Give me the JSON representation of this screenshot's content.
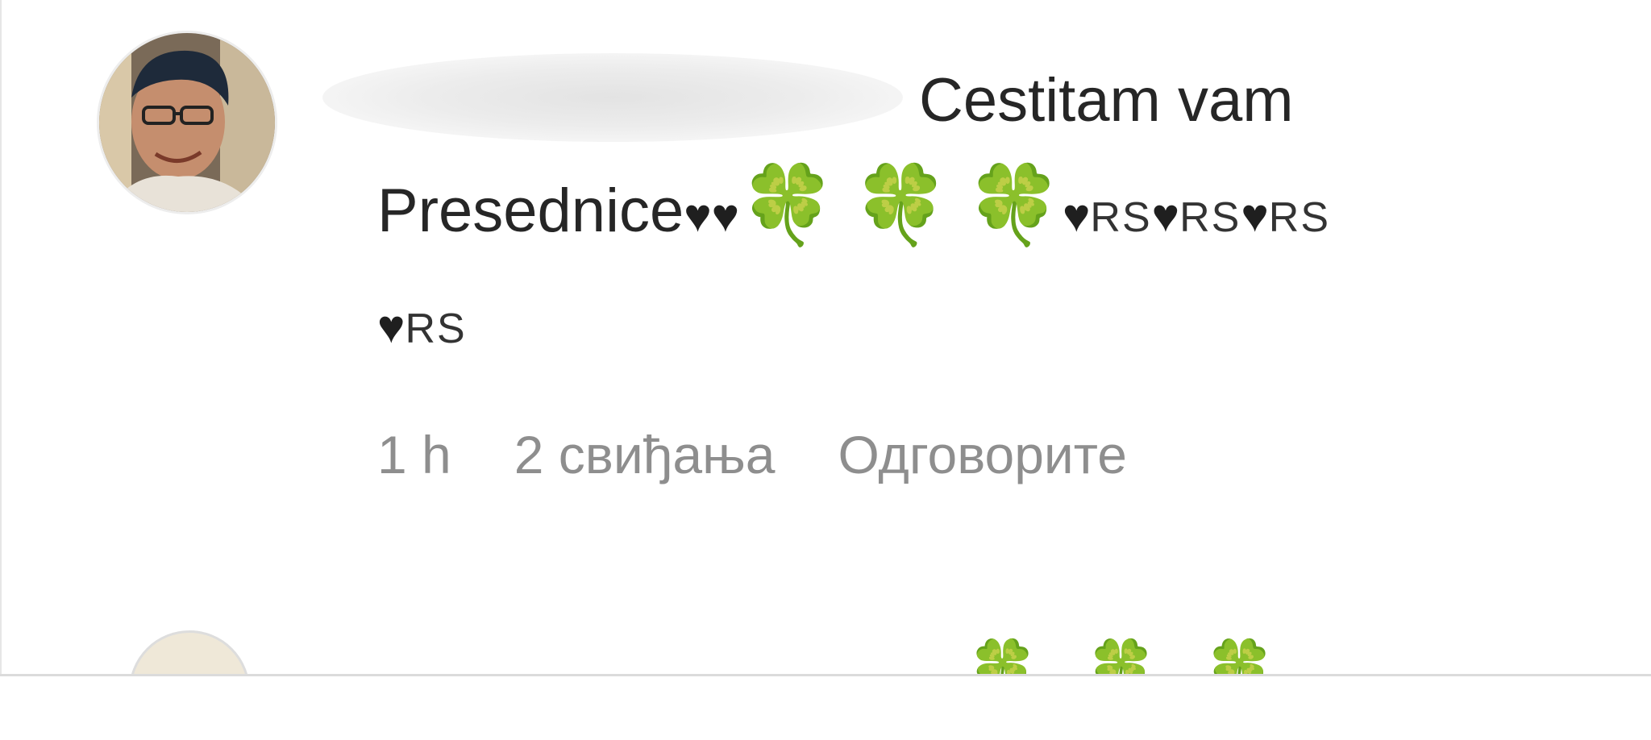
{
  "comment": {
    "text_main": "Cestitam vam",
    "text_line2": "Presednice",
    "hearts_1": "♥♥",
    "clovers": [
      "🍀",
      "🍀",
      "🍀"
    ],
    "heart_flag_sequence": [
      {
        "heart": "♥",
        "flag": "RS"
      },
      {
        "heart": "♥",
        "flag": "RS"
      },
      {
        "heart": "♥",
        "flag": "RS"
      },
      {
        "heart": "♥",
        "flag": "RS"
      }
    ],
    "meta": {
      "time": "1 h",
      "likes": "2 свиђања",
      "reply_label": "Одговорите"
    }
  },
  "next_comment": {
    "emojis": "🍀🍀🍀"
  }
}
